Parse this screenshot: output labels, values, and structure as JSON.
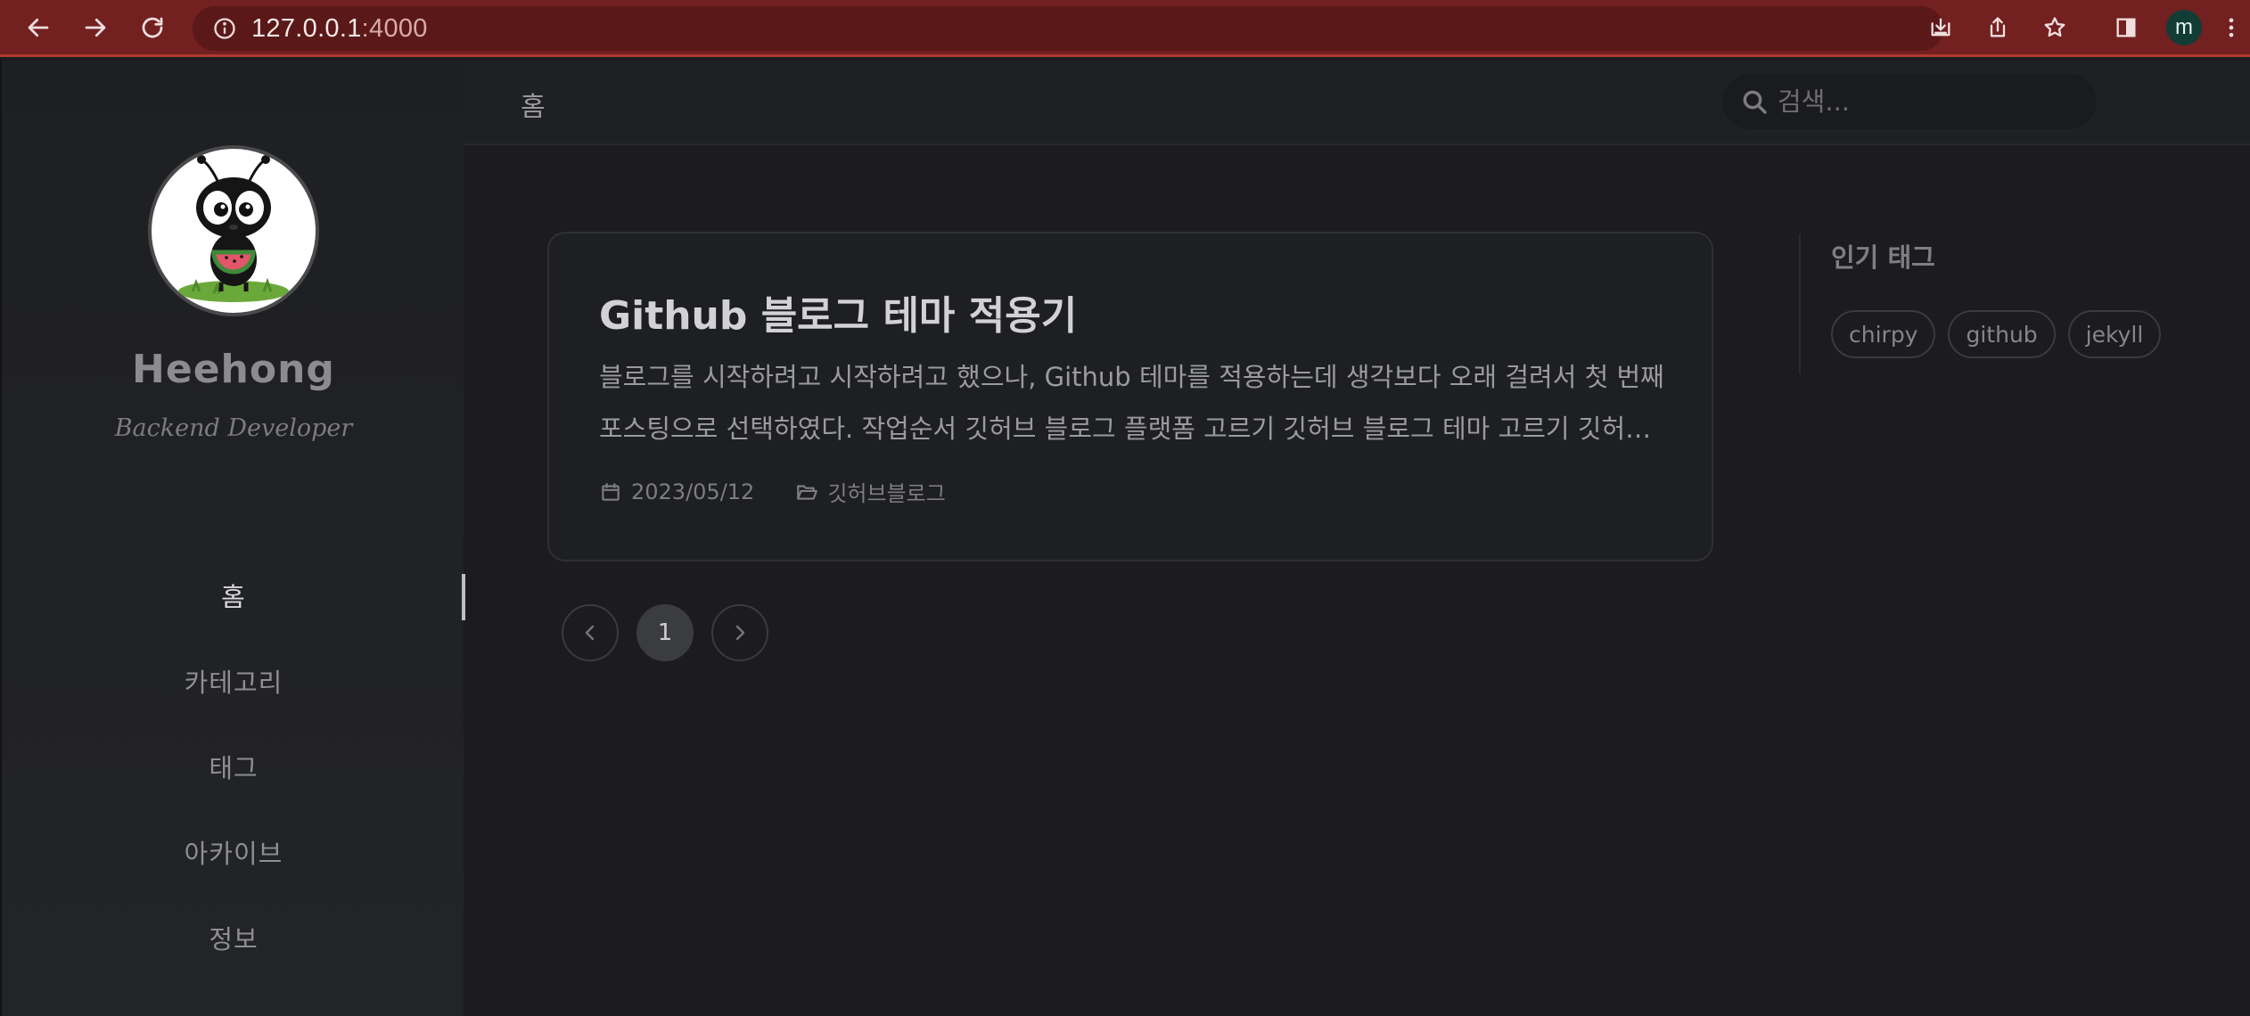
{
  "browser": {
    "url_host": "127.0.0.1",
    "url_port": ":4000",
    "profile_initial": "m"
  },
  "sidebar": {
    "site_title": "Heehong",
    "site_subtitle": "Backend Developer",
    "nav": [
      {
        "label": "홈",
        "active": true
      },
      {
        "label": "카테고리",
        "active": false
      },
      {
        "label": "태그",
        "active": false
      },
      {
        "label": "아카이브",
        "active": false
      },
      {
        "label": "정보",
        "active": false
      }
    ]
  },
  "topbar": {
    "breadcrumb": "홈",
    "search_placeholder": "검색..."
  },
  "post": {
    "title": "Github 블로그 테마 적용기",
    "excerpt": "블로그를 시작하려고 시작하려고 했으나, Github 테마를 적용하는데 생각보다 오래 걸려서 첫 번째 포스팅으로 선택하였다. 작업순서 깃허브 블로그 플랫폼 고르기 깃허브 블로그 테마 고르기 깃허브 블로그 테마 적용하기",
    "date": "2023/05/12",
    "category": "깃허브블로그"
  },
  "pagination": {
    "current_page": "1"
  },
  "panel": {
    "title": "인기 태그",
    "tags": [
      "chirpy",
      "github",
      "jekyll"
    ]
  },
  "colors": {
    "chrome_bg": "#722020",
    "page_bg": "#1c1c1e",
    "sidebar_bg": "#1e1f22",
    "avatar_bg": "#123c36"
  }
}
